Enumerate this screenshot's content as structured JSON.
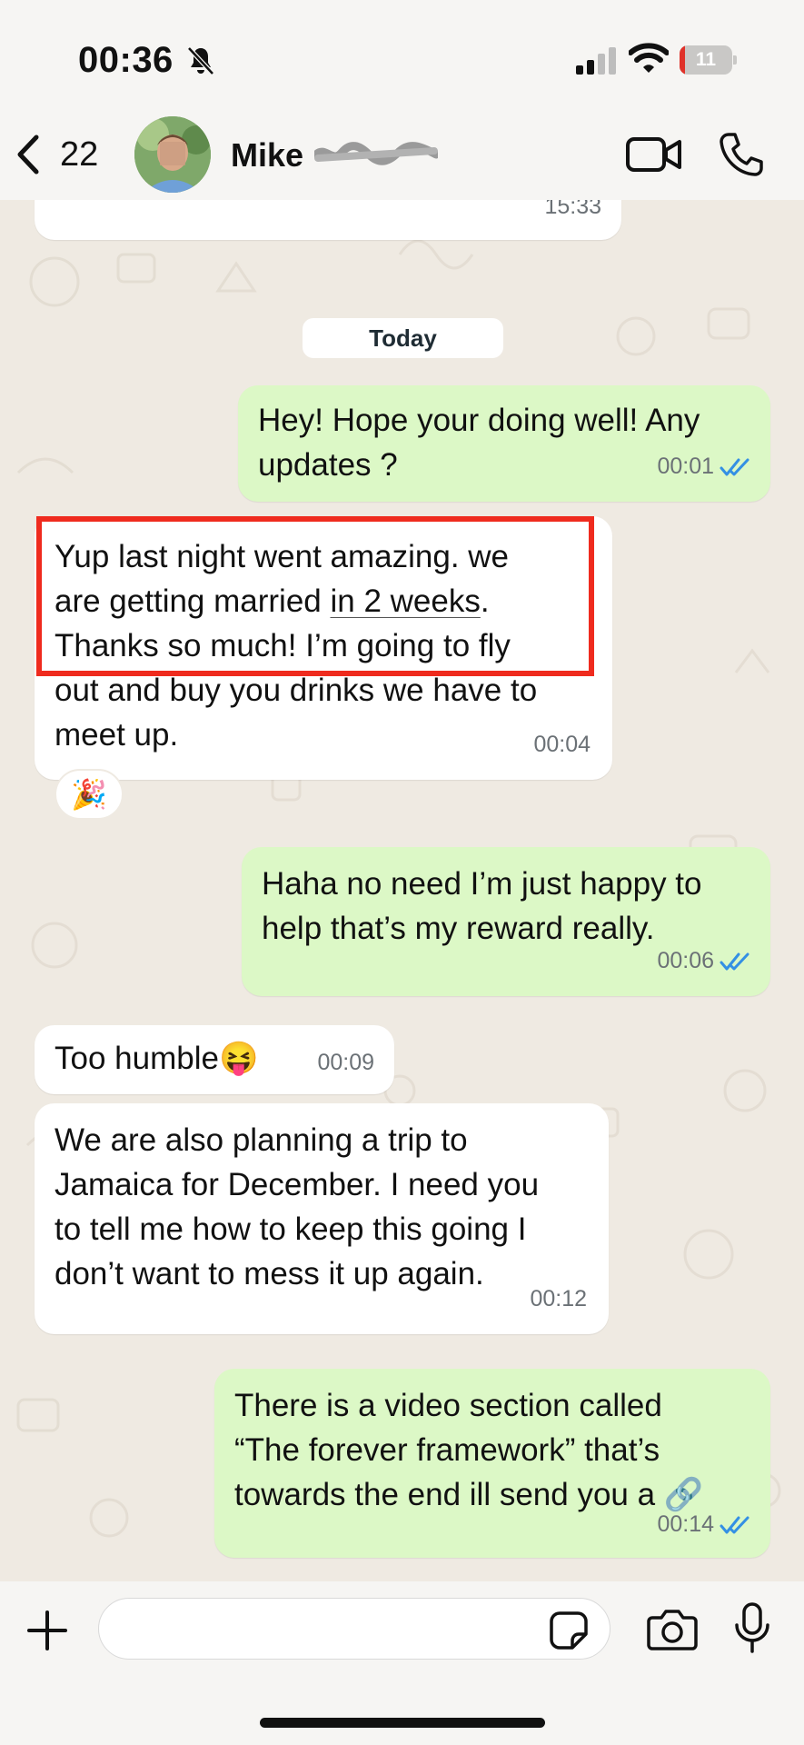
{
  "status_bar": {
    "time": "00:36",
    "battery_level": "11",
    "battery_fraction": 0.11,
    "icons": [
      "bell-slash-icon",
      "cellular-signal-icon",
      "wifi-icon",
      "battery-icon"
    ]
  },
  "header": {
    "back_count": "22",
    "contact_name": "Mike",
    "icons": [
      "chevron-left-icon",
      "video-call-icon",
      "phone-icon"
    ]
  },
  "chat": {
    "previous_message_time": "15:33",
    "date_separator": "Today",
    "messages": [
      {
        "direction": "outgoing",
        "text": "Hey! Hope your doing well! Any\nupdates ?",
        "time": "00:01",
        "status": "read"
      },
      {
        "direction": "incoming",
        "text_before": "Yup last night went amazing. we\nare getting married ",
        "text_link": "in 2 weeks",
        "text_after": ".\nThanks so much! I’m going to fly\nout and buy you drinks we have to\nmeet up.",
        "time": "00:04",
        "reaction": "🎉"
      },
      {
        "direction": "outgoing",
        "text": "Haha no need I’m just happy to\nhelp that’s my reward really.",
        "time": "00:06",
        "status": "read"
      },
      {
        "direction": "incoming",
        "text": "Too humble😝",
        "time": "00:09"
      },
      {
        "direction": "incoming",
        "text": "We are also planning a trip to\nJamaica for December. I need you\nto tell me how to keep this going I\ndon’t want to mess it up again.",
        "time": "00:12"
      },
      {
        "direction": "outgoing",
        "text": "There is a video section called\n“The forever framework” that’s\ntowards the end ill send you a 🔗",
        "time": "00:14",
        "status": "read"
      }
    ]
  },
  "input_bar": {
    "placeholder": "",
    "icons": [
      "plus-icon",
      "sticker-icon",
      "camera-icon",
      "microphone-icon"
    ]
  },
  "colors": {
    "chat_background": "#efeae2",
    "outgoing_bubble": "#dcf8c6",
    "incoming_bubble": "#ffffff",
    "read_ticks": "#3490e4",
    "highlight_box": "#ef2b1e"
  }
}
